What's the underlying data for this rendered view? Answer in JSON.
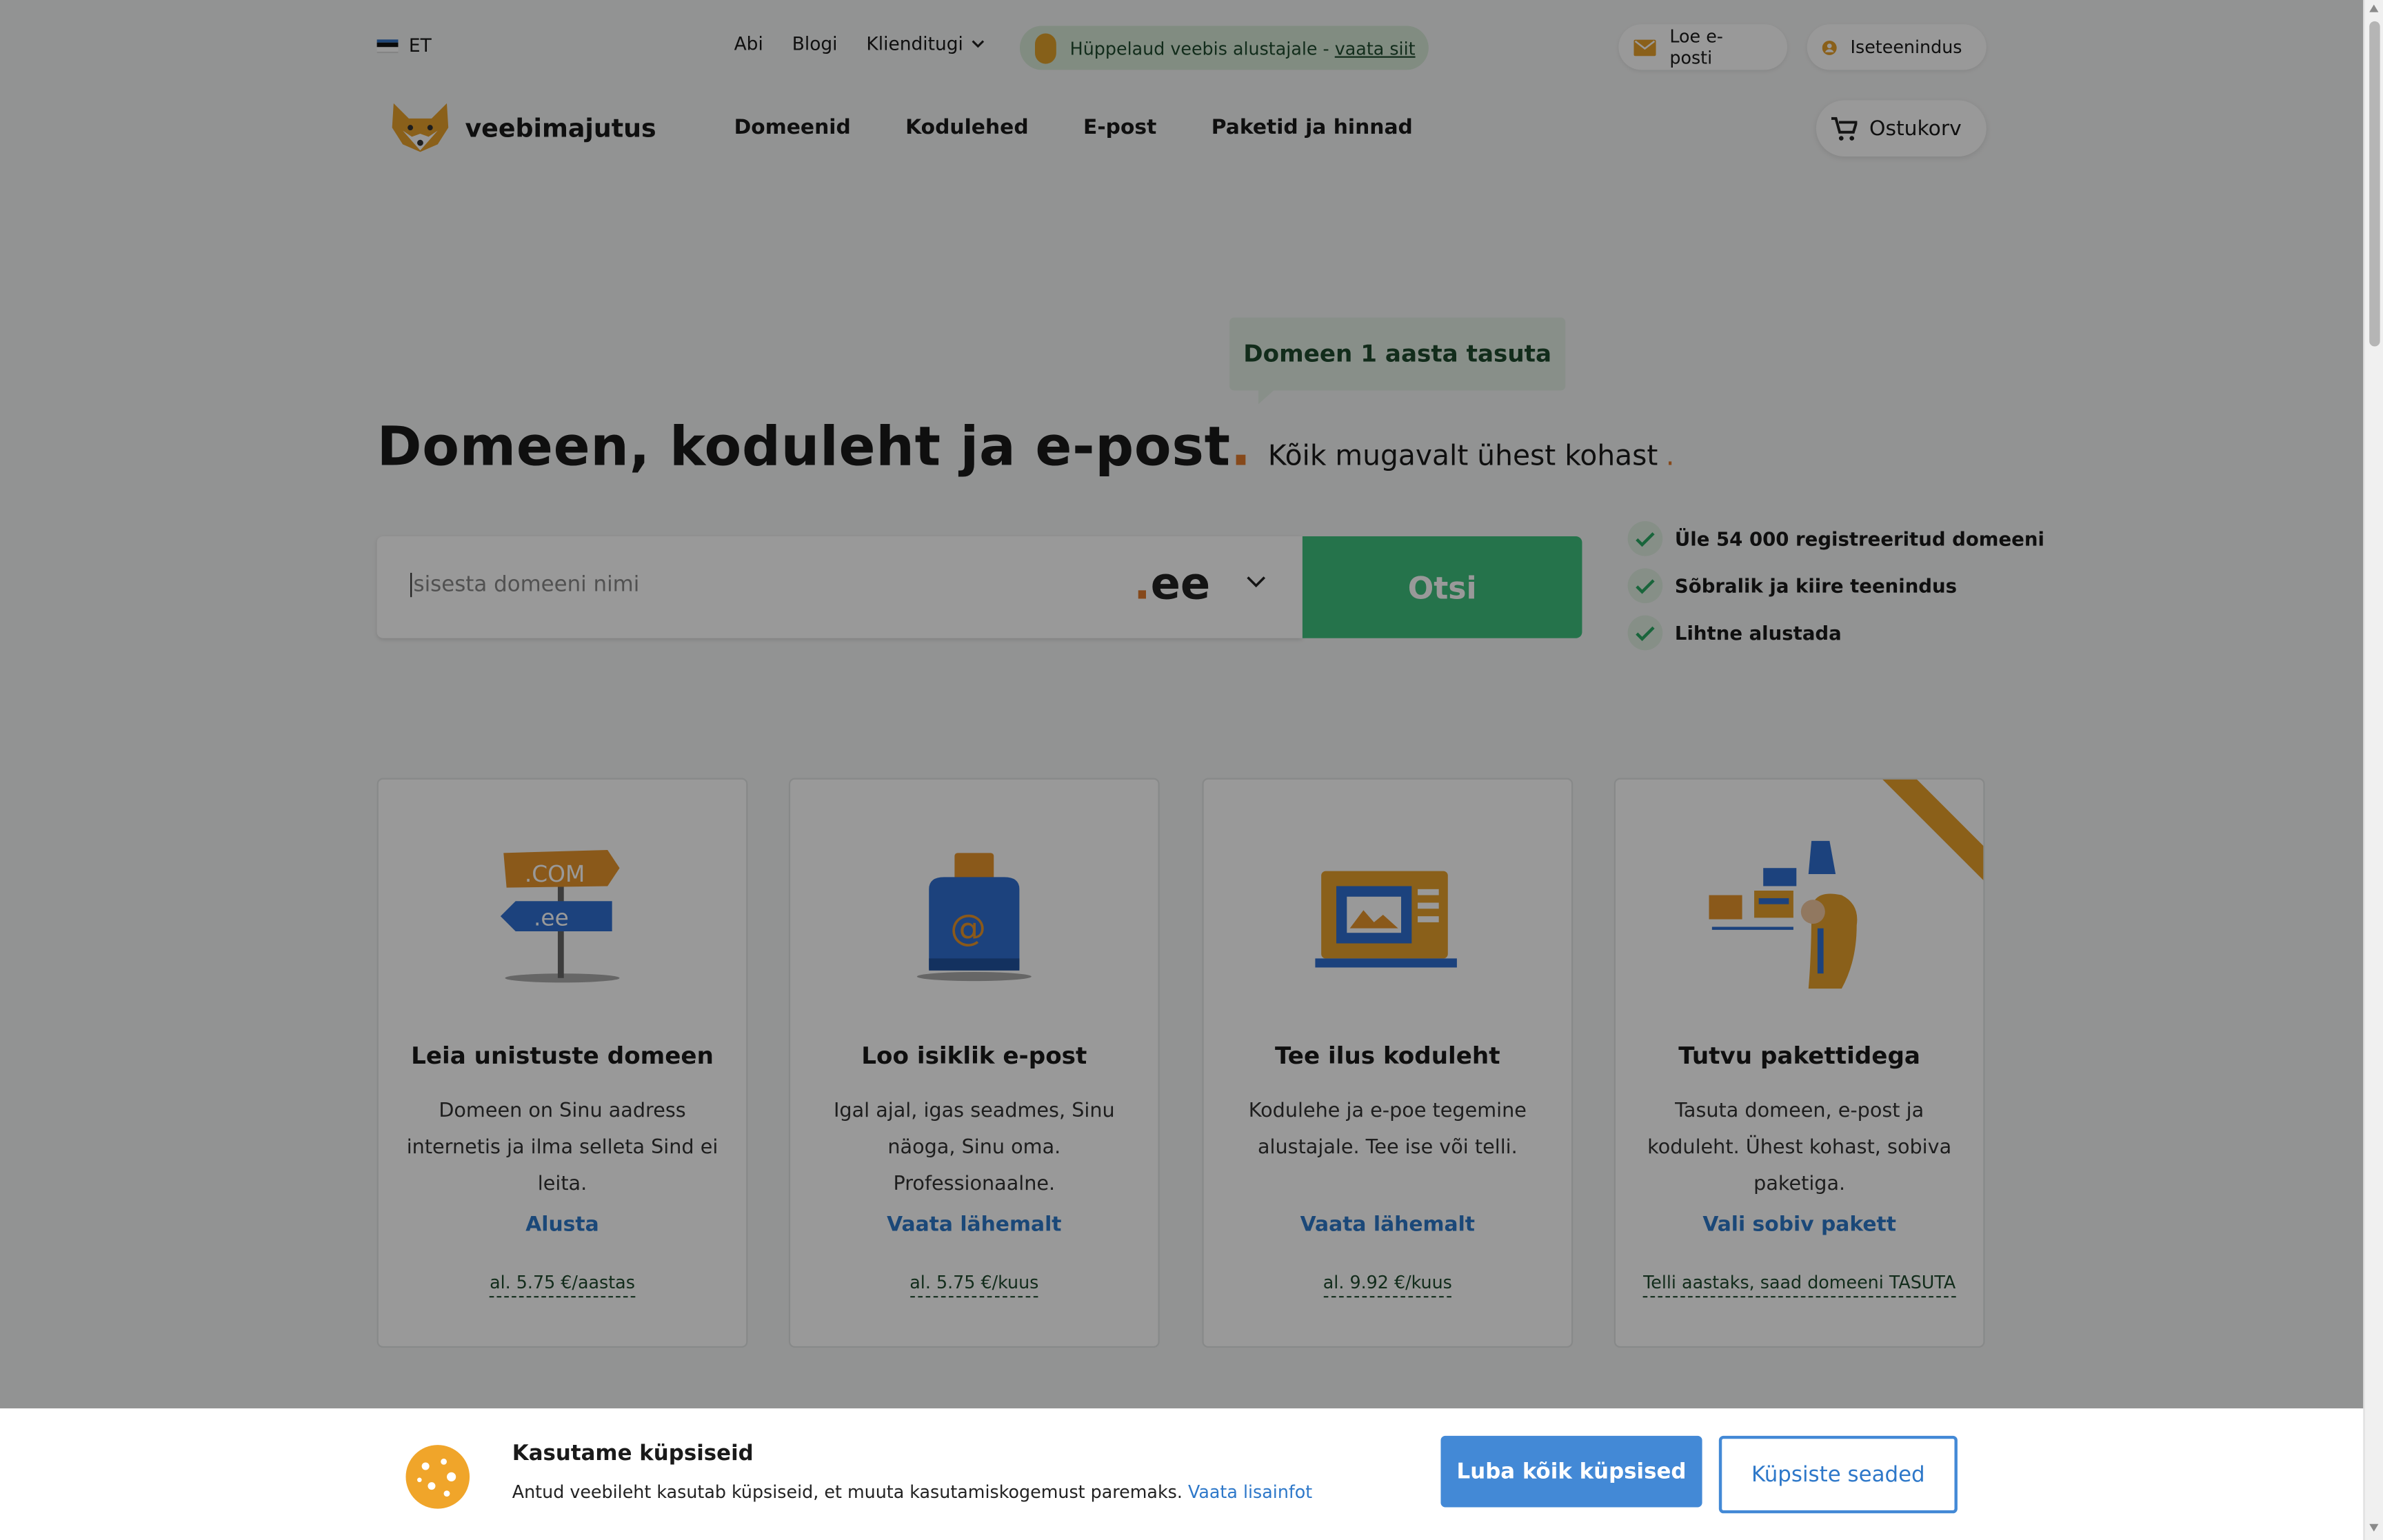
{
  "topbar": {
    "language": "ET",
    "links": [
      "Abi",
      "Blogi",
      "Klienditugi"
    ],
    "promo_text": "Hüppelaud veebis alustajale - ",
    "promo_link": "vaata siit",
    "read_mail": "Loe e-posti",
    "self_service": "Iseteenindus"
  },
  "header": {
    "logo_text": "veebimajutus",
    "nav": [
      "Domeenid",
      "Kodulehed",
      "E-post",
      "Paketid ja hinnad"
    ],
    "cart_label": "Ostukorv"
  },
  "hero": {
    "bubble": "Domeen 1 aasta tasuta",
    "title": "Domeen, koduleht ja e-post",
    "subtitle": "Kõik mugavalt ühest kohast",
    "search_placeholder": "sisesta domeeni nimi",
    "tld_dot": ".",
    "tld": "ee",
    "search_button": "Otsi",
    "benefits": [
      "Üle 54 000 registreeritud domeeni",
      "Sõbralik ja kiire teenindus",
      "Lihtne alustada"
    ]
  },
  "cards": [
    {
      "title": "Leia unistuste domeen",
      "desc": "Domeen on Sinu aadress internetis ja ilma selleta Sind ei leita.",
      "link": "Alusta",
      "price": "al. 5.75 €/aastas",
      "sign_top": ".COM",
      "sign_bottom": ".ee"
    },
    {
      "title": "Loo isiklik e-post",
      "desc": "Igal ajal, igas seadmes, Sinu näoga, Sinu oma. Professionaalne.",
      "link": "Vaata lähemalt",
      "price": "al. 5.75 €/kuus"
    },
    {
      "title": "Tee ilus koduleht",
      "desc": "Kodulehe ja e-poe tegemine alustajale. Tee ise või telli.",
      "link": "Vaata lähemalt",
      "price": "al. 9.92 €/kuus"
    },
    {
      "title": "Tutvu pakettidega",
      "desc": "Tasuta domeen, e-post ja koduleht. Ühest kohast, sobiva paketiga.",
      "link": "Vali sobiv pakett",
      "price": "Telli aastaks, saad domeeni TASUTA"
    }
  ],
  "cookie": {
    "title": "Kasutame küpsiseid",
    "text": "Antud veebileht kasutab küpsiseid, et muuta kasutamiskogemust paremaks. ",
    "more_link": "Vaata lisainfot",
    "accept_button": "Luba kõik küpsised",
    "settings_button": "Küpsiste seaded"
  },
  "colors": {
    "brand_green": "#3fc07d",
    "accent_orange": "#e07a2d",
    "link_blue": "#2e78c9"
  }
}
